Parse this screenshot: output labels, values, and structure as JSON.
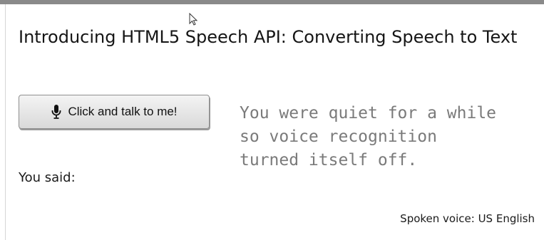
{
  "page": {
    "title": "Introducing HTML5 Speech API: Converting Speech to Text"
  },
  "talk_button": {
    "icon": "microphone-icon",
    "label": "Click and talk to me!"
  },
  "status": {
    "message": "You were quiet for a while\nso voice recognition\nturned itself off."
  },
  "transcript": {
    "label": "You said:"
  },
  "voice": {
    "info": "Spoken voice: US English"
  },
  "colors": {
    "top_border": "#8a8a8a",
    "status_text": "#7a7a7a",
    "button_bg": "#e6e6e6"
  }
}
